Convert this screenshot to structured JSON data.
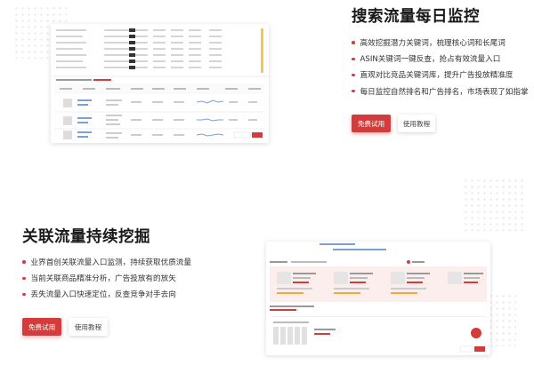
{
  "section1": {
    "title": "搜索流量每日监控",
    "features": [
      "高效挖掘潜力关键词，梳理核心词和长尾词",
      "ASIN关键词一键反查，抢占有效流量入口",
      "直观对比竞品关键词库，提升广告投放精准度",
      "每日监控自然排名和广告排名，市场表现了如指掌"
    ],
    "primary_button": "免费试用",
    "secondary_button": "使用教程"
  },
  "section2": {
    "title": "关联流量持续挖掘",
    "features": [
      "业界首创关联流量入口监测，持续获取优质流量",
      "当前关联商品精准分析，广告投放有的放矢",
      "丢失流量入口快速定位，反查竞争对手去向"
    ],
    "primary_button": "免费试用",
    "secondary_button": "使用教程"
  },
  "colors": {
    "accent": "#d43b3b",
    "bullet": "#d43b3b"
  }
}
